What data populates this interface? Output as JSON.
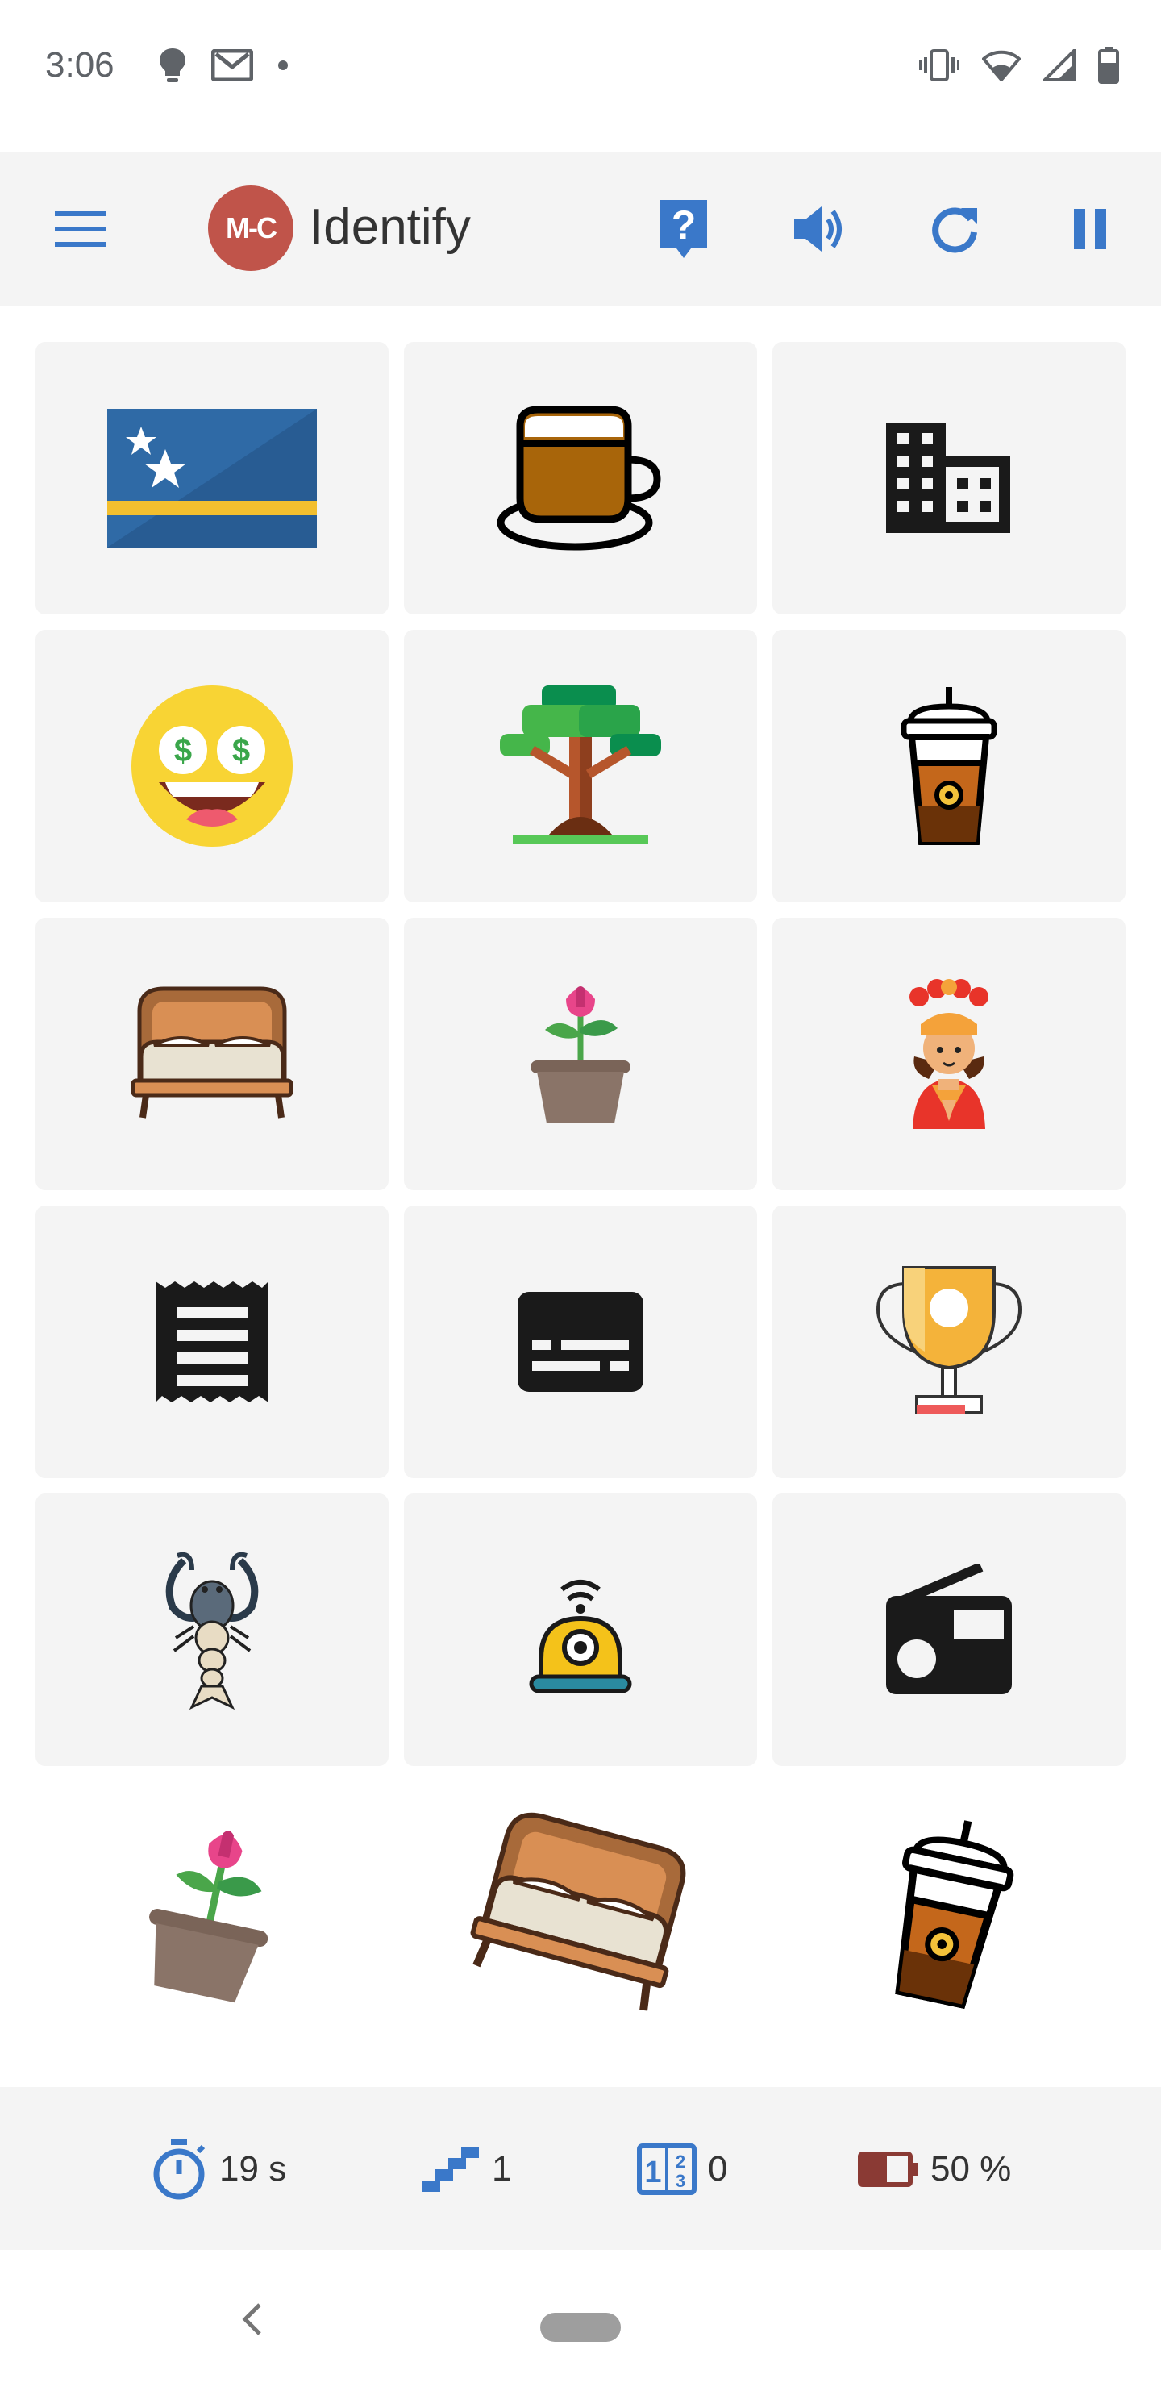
{
  "status_bar": {
    "time": "3:06",
    "left_icons": [
      "lightbulb-icon",
      "gmail-icon",
      "dot-icon"
    ],
    "right_icons": [
      "vibrate-icon",
      "wifi-icon",
      "signal-icon",
      "battery-icon"
    ]
  },
  "app_bar": {
    "logo_text": "M-C",
    "title": "Identify",
    "actions": [
      "help-icon",
      "volume-icon",
      "refresh-icon",
      "pause-icon"
    ],
    "accent_color": "#3a78c9"
  },
  "grid": {
    "tiles": [
      {
        "icon": "curacao-flag-icon"
      },
      {
        "icon": "coffee-cup-icon"
      },
      {
        "icon": "office-building-icon"
      },
      {
        "icon": "money-face-emoji-icon"
      },
      {
        "icon": "tree-icon"
      },
      {
        "icon": "iced-coffee-icon"
      },
      {
        "icon": "bed-icon"
      },
      {
        "icon": "potted-flower-icon"
      },
      {
        "icon": "dancer-icon"
      },
      {
        "icon": "receipt-icon"
      },
      {
        "icon": "subtitles-icon"
      },
      {
        "icon": "trophy-icon"
      },
      {
        "icon": "crayfish-icon"
      },
      {
        "icon": "robot-vacuum-icon"
      },
      {
        "icon": "radio-icon"
      }
    ]
  },
  "targets": [
    {
      "icon": "potted-flower-icon"
    },
    {
      "icon": "bed-icon"
    },
    {
      "icon": "iced-coffee-icon"
    }
  ],
  "stats": {
    "time": "19 s",
    "level": "1",
    "score": "0",
    "battery": "50 %"
  }
}
